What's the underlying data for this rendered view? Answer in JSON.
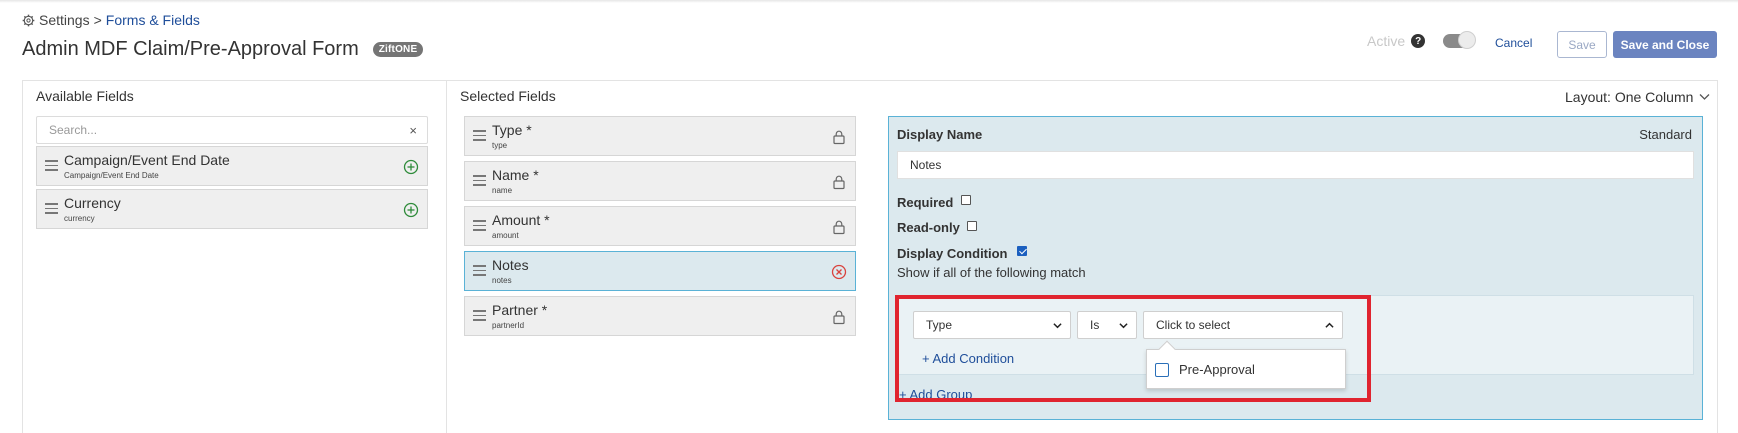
{
  "breadcrumb": {
    "root": "Settings",
    "separator": ">",
    "current": "Forms & Fields"
  },
  "page": {
    "title": "Admin MDF Claim/Pre-Approval Form",
    "badge": "ZiftONE"
  },
  "header": {
    "active_label": "Active",
    "help": "?",
    "active_toggle_on": true,
    "cancel_label": "Cancel",
    "save_label": "Save",
    "save_close_label": "Save and Close"
  },
  "available": {
    "title": "Available Fields",
    "search_placeholder": "Search...",
    "clear": "×",
    "fields": [
      {
        "label": "Campaign/Event End Date",
        "sub": "Campaign/Event End Date"
      },
      {
        "label": "Currency",
        "sub": "currency"
      }
    ]
  },
  "selected": {
    "title": "Selected Fields",
    "layout_label": "Layout: One Column",
    "fields": [
      {
        "label": "Type *",
        "sub": "type",
        "icon": "lock-icon"
      },
      {
        "label": "Name *",
        "sub": "name",
        "icon": "lock-icon"
      },
      {
        "label": "Amount *",
        "sub": "amount",
        "icon": "lock-icon"
      },
      {
        "label": "Notes",
        "sub": "notes",
        "icon": "remove-circle-icon"
      },
      {
        "label": "Partner *",
        "sub": "partnerId",
        "icon": "lock-icon"
      }
    ]
  },
  "config": {
    "display_name_label": "Display Name",
    "standard_label": "Standard",
    "display_name_value": "Notes",
    "required_label": "Required",
    "required_checked": false,
    "readonly_label": "Read-only",
    "readonly_checked": false,
    "condition_label": "Display Condition",
    "condition_checked": true,
    "show_if": "Show if all of the following match",
    "condition_field": "Type",
    "condition_operator": "Is",
    "condition_value_placeholder": "Click to select",
    "add_condition": "+ Add Condition",
    "add_group": "+ Add Group",
    "dropdown_options": [
      "Pre-Approval"
    ]
  },
  "colors": {
    "accent": "#1f4e9a",
    "primary_button": "#6b84c0",
    "panel_bg": "#dce9ee",
    "panel_border": "#5ab2d6",
    "highlight": "#e0242f",
    "add_icon": "#2e8b3a",
    "remove_icon": "#d9423d"
  }
}
